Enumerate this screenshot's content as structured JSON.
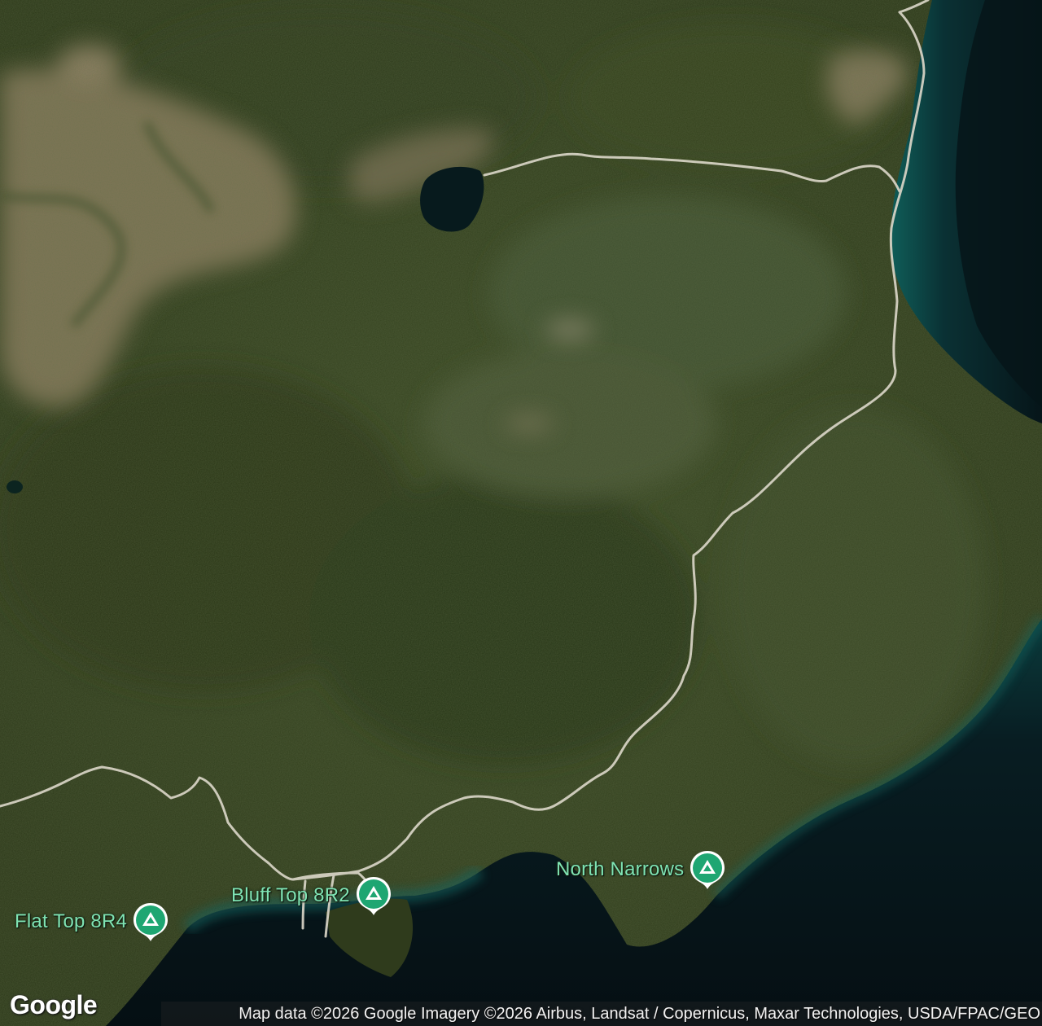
{
  "map": {
    "view": "satellite",
    "colors": {
      "forest": "#34421f",
      "forest_dark": "#273317",
      "clearing": "#8a7a60",
      "water_deep": "#06151a",
      "water_shallow": "#0f5a55",
      "road": "#d8d4c6",
      "pin_green": "#1ea672",
      "label_green": "#7fe3b3"
    }
  },
  "pins": [
    {
      "label": "Flat Top 8R4",
      "icon": "campground-icon"
    },
    {
      "label": "Bluff Top 8R2",
      "icon": "campground-icon"
    },
    {
      "label": "North Narrows",
      "icon": "campground-icon"
    }
  ],
  "branding": {
    "logo": "Google"
  },
  "attribution": {
    "text": "Map data ©2026 Google Imagery ©2026 Airbus, Landsat / Copernicus, Maxar Technologies, USDA/FPAC/GEO"
  }
}
